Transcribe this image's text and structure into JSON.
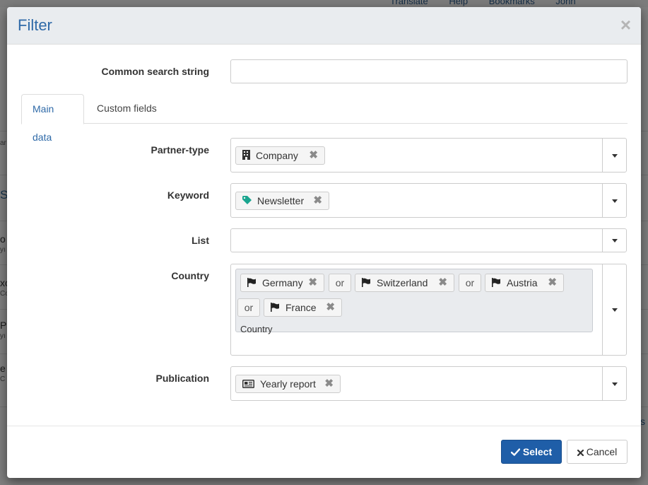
{
  "background": {
    "nav_items": [
      "Translate",
      "Help",
      "Bookmarks",
      "John"
    ],
    "fragments": [
      "ar",
      "S",
      "o",
      "yı",
      "xo",
      "Co",
      "P",
      "yı",
      "e",
      "C",
      "s"
    ]
  },
  "modal": {
    "title": "Filter",
    "close_icon": "×",
    "common_search": {
      "label": "Common search string",
      "value": "",
      "placeholder": ""
    },
    "tabs": [
      {
        "label": "Main data",
        "active": true
      },
      {
        "label": "Custom fields",
        "active": false
      }
    ],
    "fields": {
      "partner_type": {
        "label": "Partner-type",
        "chips": [
          {
            "text": "Company",
            "icon": "building-icon"
          }
        ]
      },
      "keyword": {
        "label": "Keyword",
        "chips": [
          {
            "text": "Newsletter",
            "icon": "tag-icon"
          }
        ]
      },
      "list": {
        "label": "List",
        "chips": []
      },
      "country": {
        "label": "Country",
        "chips": [
          {
            "text": "Germany",
            "icon": "flag-icon"
          },
          {
            "text": "Switzerland",
            "icon": "flag-icon"
          },
          {
            "text": "Austria",
            "icon": "flag-icon"
          },
          {
            "text": "France",
            "icon": "flag-icon"
          }
        ],
        "connector": "or",
        "group_label": "Country"
      },
      "publication": {
        "label": "Publication",
        "chips": [
          {
            "text": "Yearly report",
            "icon": "newspaper-icon"
          }
        ]
      }
    },
    "remove_icon": "✖",
    "footer": {
      "select_label": "Select",
      "cancel_label": "Cancel"
    },
    "colors": {
      "primary": "#1f5ea8",
      "title": "#2f6aa8",
      "tag_icon": "#1aa58f"
    }
  }
}
